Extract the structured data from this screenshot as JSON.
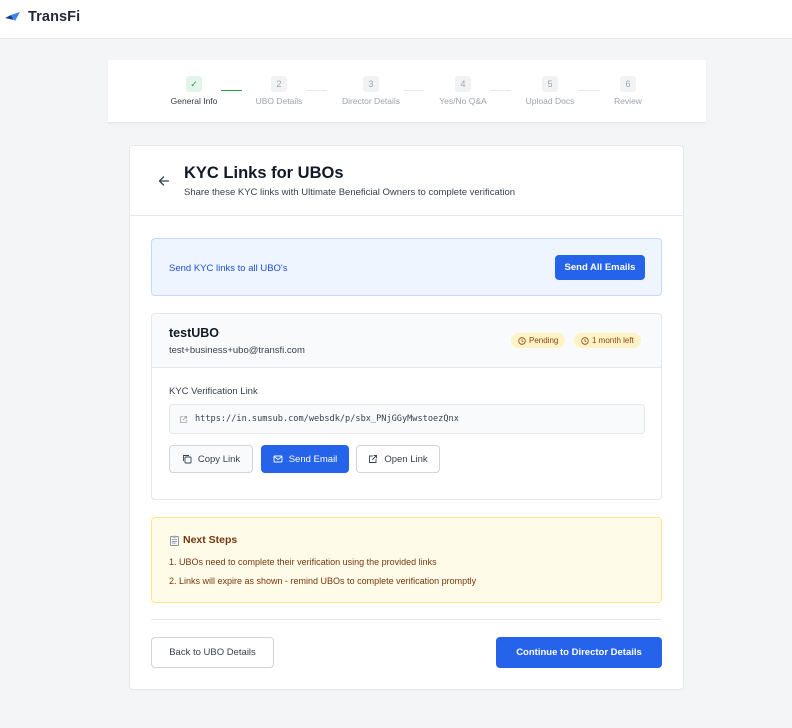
{
  "app": {
    "brand_name": "TransFi"
  },
  "stepper": {
    "steps": [
      {
        "number": "✓",
        "label": "General Info",
        "status": "done"
      },
      {
        "number": "2",
        "label": "UBO Details",
        "status": "pending"
      },
      {
        "number": "3",
        "label": "Director Details",
        "status": "pending"
      },
      {
        "number": "4",
        "label": "Yes/No Q&A",
        "status": "pending"
      },
      {
        "number": "5",
        "label": "Upload Docs",
        "status": "pending"
      },
      {
        "number": "6",
        "label": "Review",
        "status": "pending"
      }
    ]
  },
  "header": {
    "title": "KYC Links for UBOs",
    "subtitle": "Share these KYC links with Ultimate Beneficial Owners to complete verification"
  },
  "send_all": {
    "text": "Send KYC links to all UBO's",
    "button_label": "Send All Emails"
  },
  "ubo": {
    "name": "testUBO",
    "email": "test+business+ubo@transfi.com",
    "status_badge": "Pending",
    "time_badge": "1 month left",
    "link_label": "KYC Verification Link",
    "link_url": "https://in.sumsub.com/websdk/p/sbx_PNjGGyMwstoezQnx",
    "copy_label": "Copy Link",
    "email_label": "Send Email",
    "open_label": "Open Link"
  },
  "next_steps": {
    "title": "Next Steps",
    "items": [
      "1. UBOs need to complete their verification using the provided links",
      "2. Links will expire as shown - remind UBOs to complete verification promptly"
    ]
  },
  "footer": {
    "back_label": "Back to UBO Details",
    "continue_label": "Continue to Director Details"
  },
  "colors": {
    "primary": "#2563eb",
    "success": "#16a34a",
    "pending_badge_bg": "#fef3c7",
    "next_steps_bg": "#fefce8",
    "info_bg": "#eef5fe"
  },
  "icons": {
    "brand": "transfi-logo-icon",
    "back": "arrow-left-icon",
    "clock": "clock-icon",
    "external": "external-link-icon",
    "copy": "copy-icon",
    "mail": "mail-icon",
    "clipboard": "clipboard-icon"
  }
}
